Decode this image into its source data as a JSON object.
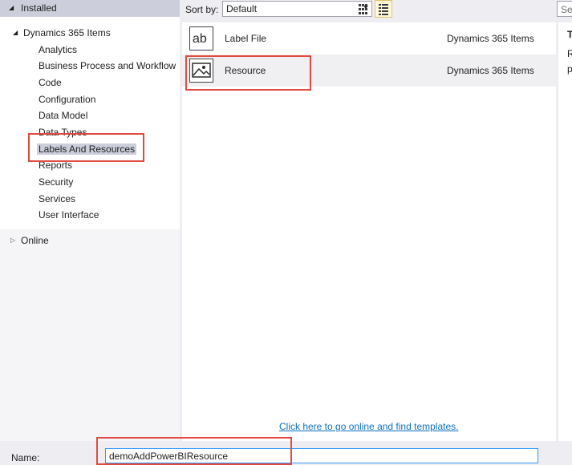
{
  "tree": {
    "installed_label": "Installed",
    "root_label": "Dynamics 365 Items",
    "items": [
      {
        "label": "Analytics"
      },
      {
        "label": "Business Process and Workflow"
      },
      {
        "label": "Code"
      },
      {
        "label": "Configuration"
      },
      {
        "label": "Data Model"
      },
      {
        "label": "Data Types"
      },
      {
        "label": "Labels And Resources",
        "selected": true
      },
      {
        "label": "Reports"
      },
      {
        "label": "Security"
      },
      {
        "label": "Services"
      },
      {
        "label": "User Interface"
      }
    ],
    "online_label": "Online"
  },
  "toolbar": {
    "sort_label": "Sort by:",
    "sort_value": "Default",
    "search_placeholder": "Se"
  },
  "templates": [
    {
      "name": "Label File",
      "category": "Dynamics 365 Items",
      "icon": "label-file-icon",
      "icon_text": "ab"
    },
    {
      "name": "Resource",
      "category": "Dynamics 365 Items",
      "icon": "image-resource-icon",
      "selected": true
    }
  ],
  "online_link": "Click here to go online and find templates.",
  "details": {
    "title": "T",
    "line1": "R",
    "line2": "p"
  },
  "name_field": {
    "label": "Name:",
    "value": "demoAddPowerBIResource"
  },
  "colors": {
    "highlight": "#e04a3f",
    "link": "#0e70c0",
    "selection": "#cccedb"
  }
}
